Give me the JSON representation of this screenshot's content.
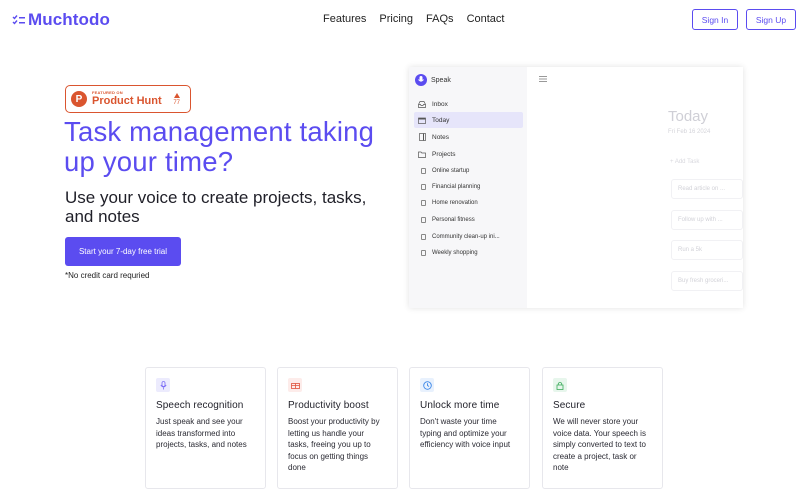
{
  "header": {
    "brand": "Muchtodo",
    "nav": [
      "Features",
      "Pricing",
      "FAQs",
      "Contact"
    ],
    "sign_in": "Sign In",
    "sign_up": "Sign Up"
  },
  "badge": {
    "featured_on": "FEATURED ON",
    "name": "Product Hunt",
    "votes": "77",
    "logo_letter": "P"
  },
  "hero": {
    "title": "Task management taking up your time?",
    "subtitle": "Use your voice to create projects, tasks, and notes",
    "cta": "Start your 7-day free trial",
    "note": "*No credit card requried"
  },
  "preview": {
    "app_name": "Speak",
    "nav": [
      {
        "label": "Inbox",
        "icon": "inbox-icon"
      },
      {
        "label": "Today",
        "icon": "calendar-icon"
      },
      {
        "label": "Notes",
        "icon": "notes-icon"
      },
      {
        "label": "Projects",
        "icon": "folder-icon"
      }
    ],
    "projects": [
      "Online startup",
      "Financial planning",
      "Home renovation",
      "Personal fitness",
      "Community clean-up ini...",
      "Weekly shopping"
    ],
    "main_title": "Today",
    "date": "Fri Feb 16 2024",
    "add_task": "+ Add Task",
    "tasks": [
      "Read article on ...",
      "Follow up with ...",
      "Run a 5k",
      "Buy fresh groceri..."
    ]
  },
  "features": [
    {
      "title": "Speech recognition",
      "body": "Just speak and see your ideas transformed into projects, tasks, and notes",
      "icon": "microphone-icon",
      "color": "#7b6cf6",
      "bg": "#ecebfd"
    },
    {
      "title": "Productivity boost",
      "body": "Boost your productivity by letting us handle your tasks, freeing you up to focus on getting things done",
      "icon": "gift-icon",
      "color": "#e0523b",
      "bg": "#fdecea"
    },
    {
      "title": "Unlock more time",
      "body": "Don't waste your time typing and optimize your efficiency with voice input",
      "icon": "clock-icon",
      "color": "#3a86e8",
      "bg": "#e8f1fd"
    },
    {
      "title": "Secure",
      "body": "We will never store your voice data. Your speech is simply converted to text to create a project, task or note",
      "icon": "lock-icon",
      "color": "#3caa5a",
      "bg": "#e7f6ec"
    }
  ],
  "colors": {
    "accent": "#5b4cf0",
    "product_hunt": "#da552f"
  }
}
